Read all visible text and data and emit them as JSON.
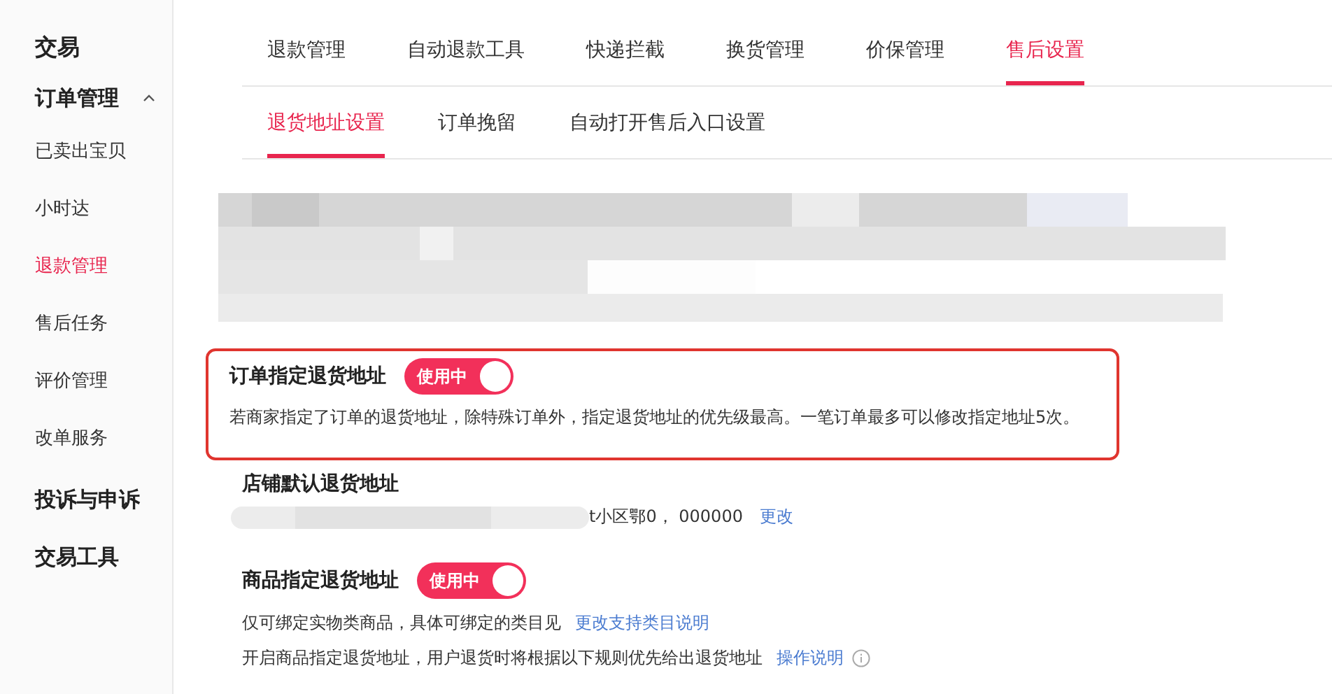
{
  "sidebar": {
    "title": "交易",
    "groups": [
      {
        "label": "订单管理",
        "expanded": true,
        "items": [
          {
            "label": "已卖出宝贝",
            "selected": false
          },
          {
            "label": "小时达",
            "selected": false
          },
          {
            "label": "退款管理",
            "selected": true
          },
          {
            "label": "售后任务",
            "selected": false
          },
          {
            "label": "评价管理",
            "selected": false
          },
          {
            "label": "改单服务",
            "selected": false
          }
        ]
      },
      {
        "label": "投诉与申诉",
        "expanded": false
      },
      {
        "label": "交易工具",
        "expanded": false
      }
    ]
  },
  "tabs": [
    {
      "label": "退款管理",
      "selected": false
    },
    {
      "label": "自动退款工具",
      "selected": false
    },
    {
      "label": "快递拦截",
      "selected": false
    },
    {
      "label": "换货管理",
      "selected": false
    },
    {
      "label": "价保管理",
      "selected": false
    },
    {
      "label": "售后设置",
      "selected": true
    }
  ],
  "subtabs": [
    {
      "label": "退货地址设置",
      "selected": true
    },
    {
      "label": "订单挽留",
      "selected": false
    },
    {
      "label": "自动打开售后入口设置",
      "selected": false
    }
  ],
  "order_address": {
    "title": "订单指定退货地址",
    "toggle": {
      "label": "使用中",
      "on": true
    },
    "highlighted": true,
    "description": "若商家指定了订单的退货地址，除特殊订单外，指定退货地址的优先级最高。一笔订单最多可以修改指定地址5次。"
  },
  "shop_address": {
    "title": "店铺默认退货地址",
    "address": "t小区鄂0，  000000",
    "link": "更改"
  },
  "product_address": {
    "title": "商品指定退货地址",
    "toggle": {
      "label": "使用中",
      "on": true
    },
    "lines": [
      {
        "text": "仅可绑定实物类商品，具体可绑定的类目见",
        "link": "更改支持类目说明",
        "info": false
      },
      {
        "text": "开启商品指定退货地址，用户退货时将根据以下规则优先给出退货地址",
        "link": "操作说明",
        "info": true
      }
    ]
  }
}
